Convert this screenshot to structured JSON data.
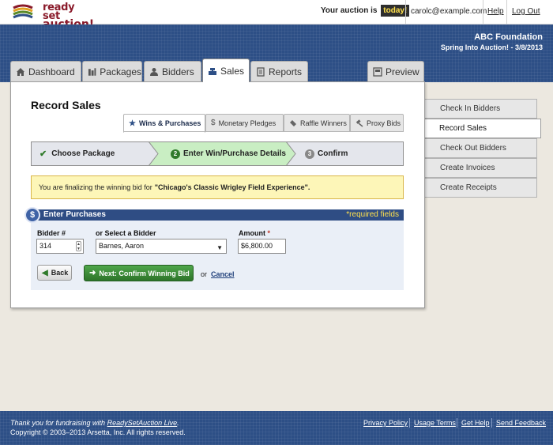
{
  "brand": {
    "logo_line1": "ready set",
    "logo_line2": "auction!"
  },
  "topbar": {
    "status_prefix": "Your auction is",
    "status_badge": "today!",
    "user_email": "carolc@example.com",
    "help_link": "Help",
    "logout_link": "Log Out"
  },
  "header": {
    "org_name": "ABC Foundation",
    "event_name": "Spring Into Auction! - 3/8/2013"
  },
  "main_tabs": [
    {
      "label": "Dashboard",
      "icon": "home-icon"
    },
    {
      "label": "Packages",
      "icon": "packages-icon"
    },
    {
      "label": "Bidders",
      "icon": "person-icon"
    },
    {
      "label": "Sales",
      "icon": "cash-register-icon",
      "active": true
    },
    {
      "label": "Reports",
      "icon": "report-icon"
    },
    {
      "label": "Preview",
      "icon": "preview-icon"
    }
  ],
  "page": {
    "title": "Record Sales"
  },
  "sub_tabs": [
    {
      "label": "Wins & Purchases",
      "icon": "star-icon",
      "active": true
    },
    {
      "label": "Monetary Pledges",
      "icon": "dollar-icon"
    },
    {
      "label": "Raffle Winners",
      "icon": "ticket-icon"
    },
    {
      "label": "Proxy Bids",
      "icon": "gavel-icon"
    }
  ],
  "wizard": {
    "steps": [
      {
        "label": "Choose Package",
        "state": "done"
      },
      {
        "number": "2",
        "label": "Enter Win/Purchase Details",
        "state": "current"
      },
      {
        "number": "3",
        "label": "Confirm",
        "state": "pending"
      }
    ]
  },
  "notice": {
    "prefix": "You are finalizing the winning bid for",
    "package": "\"Chicago's Classic Wrigley Field Experience\"."
  },
  "purchases": {
    "heading": "Enter Purchases",
    "required_note": "*required fields",
    "bidder_number_label": "Bidder #",
    "bidder_number_value": "314",
    "select_bidder_label": "or Select a Bidder",
    "select_bidder_value": "Barnes, Aaron",
    "amount_label": "Amount",
    "amount_required_marker": "*",
    "amount_value": "$6,800.00",
    "back_button": "Back",
    "next_button": "Next: Confirm Winning Bid",
    "or_text": "or",
    "cancel_link": "Cancel"
  },
  "side_menu": [
    {
      "label": "Check In Bidders"
    },
    {
      "label": "Record Sales",
      "active": true
    },
    {
      "label": "Check Out Bidders"
    },
    {
      "label": "Create Invoices"
    },
    {
      "label": "Create Receipts"
    }
  ],
  "footer": {
    "thanks_prefix": "Thank you for fundraising with",
    "thanks_link": "ReadySetAuction Live",
    "thanks_suffix": ".",
    "copyright": "Copyright © 2003–2013 Arsetta, Inc. All rights reserved.",
    "links": [
      "Privacy Policy",
      "Usage Terms",
      "Get Help",
      "Send Feedback"
    ]
  },
  "colors": {
    "header_blue": "#2d4f86",
    "current_step_green": "#c9eec3",
    "notice_yellow": "#fdf6b8",
    "next_button_green": "#3d8d38",
    "today_badge": "#ffe14d"
  }
}
